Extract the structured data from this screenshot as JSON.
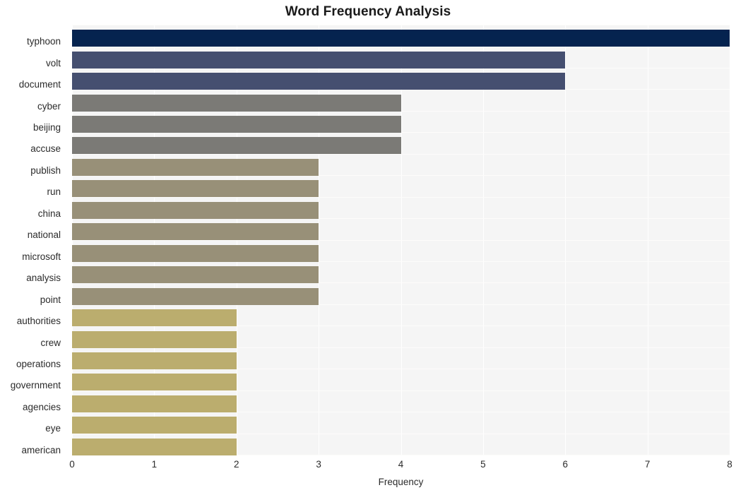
{
  "chart_data": {
    "type": "bar",
    "orientation": "horizontal",
    "title": "Word Frequency Analysis",
    "xlabel": "Frequency",
    "ylabel": "",
    "xlim": [
      0,
      8
    ],
    "xticks": [
      0,
      1,
      2,
      3,
      4,
      5,
      6,
      7,
      8
    ],
    "xticklabels": [
      "0",
      "1",
      "2",
      "3",
      "4",
      "5",
      "6",
      "7",
      "8"
    ],
    "grid": true,
    "legend": null,
    "categories": [
      "typhoon",
      "volt",
      "document",
      "cyber",
      "beijing",
      "accuse",
      "publish",
      "run",
      "china",
      "national",
      "microsoft",
      "analysis",
      "point",
      "authorities",
      "crew",
      "operations",
      "government",
      "agencies",
      "eye",
      "american"
    ],
    "values": [
      8,
      6,
      6,
      4,
      4,
      4,
      3,
      3,
      3,
      3,
      3,
      3,
      3,
      2,
      2,
      2,
      2,
      2,
      2,
      2
    ],
    "bar_colors": [
      "#05234f",
      "#454f70",
      "#454f70",
      "#7b7a76",
      "#7b7a76",
      "#7b7a76",
      "#989078",
      "#989078",
      "#989078",
      "#989078",
      "#989078",
      "#989078",
      "#989078",
      "#bbad6e",
      "#bbad6e",
      "#bbad6e",
      "#bbad6e",
      "#bbad6e",
      "#bbad6e",
      "#bbad6e"
    ]
  },
  "style": {
    "plot_background": "#f5f5f5",
    "page_background": "#ffffff",
    "gridline_color": "#ffffff",
    "text_color": "#2b2b2b",
    "title_color": "#1a1a1a"
  }
}
